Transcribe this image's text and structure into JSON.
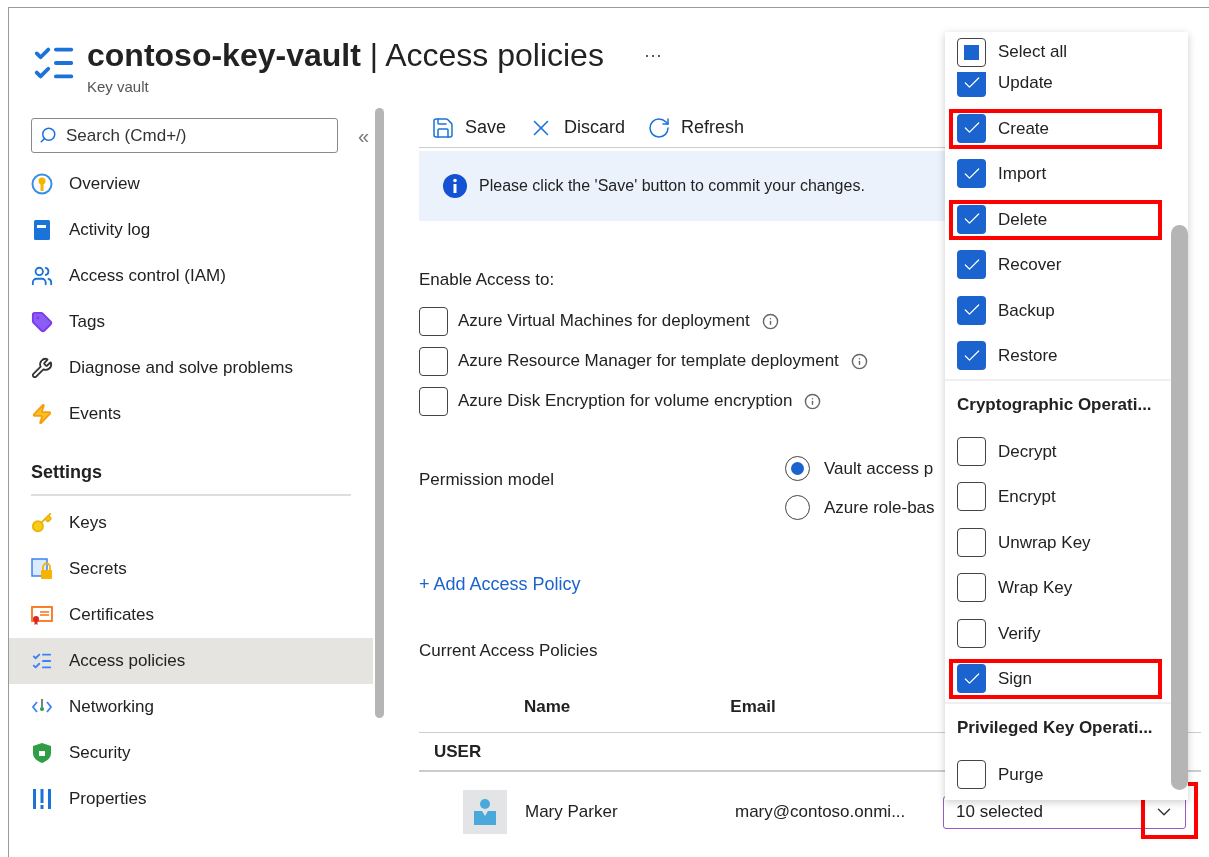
{
  "header": {
    "title": "**contoso-key-vault** | Access policies",
    "subtitle": "Key vault",
    "more": "···"
  },
  "sidebar": {
    "search": {
      "placeholder": "Search (Cmd+/)"
    },
    "collapse": "«",
    "items": [
      {
        "label": "Overview",
        "selected": false
      },
      {
        "label": "Activity log",
        "selected": false
      },
      {
        "label": "Access control (IAM)",
        "selected": false
      },
      {
        "label": "Tags",
        "selected": false
      },
      {
        "label": "Diagnose and solve problems",
        "selected": false
      },
      {
        "label": "Events",
        "selected": false
      }
    ],
    "section": "Settings",
    "settings_items": [
      {
        "label": "Keys",
        "selected": false
      },
      {
        "label": "Secrets",
        "selected": false
      },
      {
        "label": "Certificates",
        "selected": false
      },
      {
        "label": "Access policies",
        "selected": true
      },
      {
        "label": "Networking",
        "selected": false
      },
      {
        "label": "Security",
        "selected": false
      },
      {
        "label": "Properties",
        "selected": false
      }
    ]
  },
  "toolbar": [
    {
      "kind": "save",
      "label": "Save"
    },
    {
      "kind": "discard",
      "label": "Discard"
    },
    {
      "kind": "refresh",
      "label": "Refresh"
    }
  ],
  "banner": "Please click the 'Save' button to commit your changes.",
  "enable_access": {
    "label": "Enable Access to:",
    "options": [
      {
        "label": "Azure Virtual Machines for deployment",
        "checked": false
      },
      {
        "label": "Azure Resource Manager for template deployment",
        "checked": false
      },
      {
        "label": "Azure Disk Encryption for volume encryption",
        "checked": false
      }
    ]
  },
  "permission_model": {
    "label": "Permission model",
    "options": [
      {
        "label": "Vault access p",
        "selected": true
      },
      {
        "label": "Azure role-bas",
        "selected": false
      }
    ]
  },
  "add_policy": "+ Add Access Policy",
  "policies": {
    "title": "Current Access Policies",
    "columns": [
      "Name",
      "Email"
    ],
    "group": "USER",
    "rows": [
      {
        "name": "Mary Parker",
        "email": "mary@contoso.onmi...",
        "permissions": "10 selected",
        "chevron_highlighted": true
      }
    ]
  },
  "menu": {
    "select_all": {
      "label": "Select all",
      "indeterminate": true
    },
    "groups": [
      {
        "items": [
          {
            "label": "Update",
            "checked": true,
            "highlighted": false
          },
          {
            "label": "Create",
            "checked": true,
            "highlighted": true
          },
          {
            "label": "Import",
            "checked": true,
            "highlighted": false
          },
          {
            "label": "Delete",
            "checked": true,
            "highlighted": true
          },
          {
            "label": "Recover",
            "checked": true,
            "highlighted": false
          },
          {
            "label": "Backup",
            "checked": true,
            "highlighted": false
          },
          {
            "label": "Restore",
            "checked": true,
            "highlighted": false
          }
        ]
      },
      {
        "heading": "Cryptographic Operati...",
        "items": [
          {
            "label": "Decrypt",
            "checked": false,
            "highlighted": false
          },
          {
            "label": "Encrypt",
            "checked": false,
            "highlighted": false
          },
          {
            "label": "Unwrap Key",
            "checked": false,
            "highlighted": false
          },
          {
            "label": "Wrap Key",
            "checked": false,
            "highlighted": false
          },
          {
            "label": "Verify",
            "checked": false,
            "highlighted": false
          },
          {
            "label": "Sign",
            "checked": true,
            "highlighted": true
          }
        ]
      },
      {
        "heading": "Privileged Key Operati...",
        "items": [
          {
            "label": "Purge",
            "checked": false,
            "highlighted": false
          }
        ]
      }
    ]
  }
}
